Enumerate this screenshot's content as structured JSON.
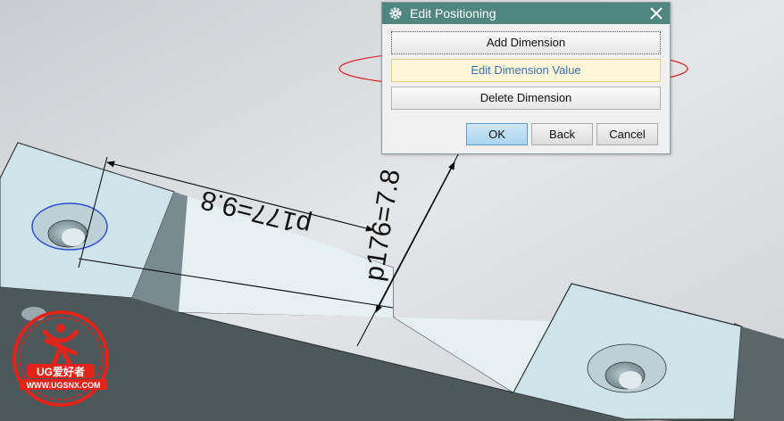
{
  "dialog": {
    "title": "Edit Positioning",
    "buttons": {
      "add_dimension": "Add Dimension",
      "edit_dimension_value": "Edit Dimension Value",
      "delete_dimension": "Delete Dimension",
      "ok": "OK",
      "back": "Back",
      "cancel": "Cancel"
    }
  },
  "viewport": {
    "dimension_horizontal": "p177=9.8",
    "dimension_vertical": "p176=7.8"
  },
  "watermark": {
    "brand": "UG爱好者",
    "url": "WWW.UGSNX.COM"
  },
  "colors": {
    "background": "#d9dcdf",
    "part_top_face": "#cde4ea",
    "part_side_face": "#4f5a5e",
    "title_bar": "#4f8680",
    "highlight_ellipse": "#d9252a",
    "watermark_red": "#e2231a"
  },
  "icons": {
    "title_icon": "gear-icon",
    "close_icon": "close-icon"
  }
}
